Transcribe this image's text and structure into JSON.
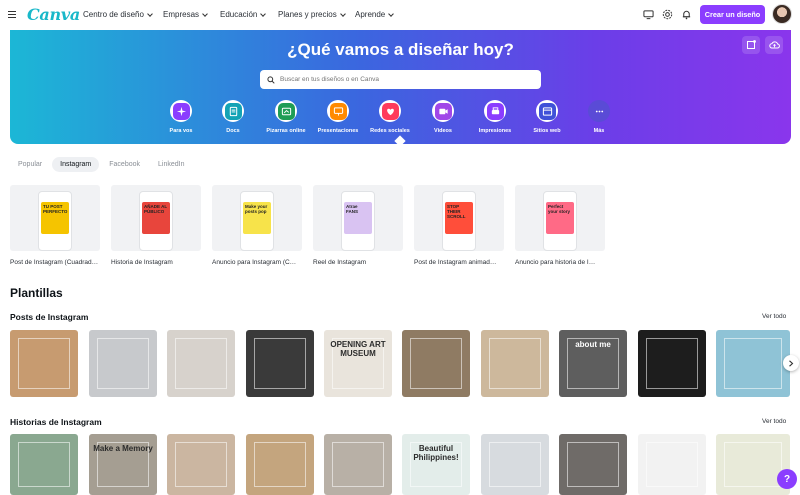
{
  "app": {
    "logo": "Canva"
  },
  "nav": {
    "items": [
      {
        "label": "Centro de diseño"
      },
      {
        "label": "Empresas"
      },
      {
        "label": "Educación"
      },
      {
        "label": "Planes y precios"
      },
      {
        "label": "Aprende"
      }
    ],
    "create_label": "Crear un diseño"
  },
  "hero": {
    "title": "¿Qué vamos a diseñar hoy?",
    "search_placeholder": "Buscar en tus diseños o en Canva",
    "categories": [
      {
        "label": "Para vos",
        "icon": "sparkle-icon",
        "color": "#8b3dff"
      },
      {
        "label": "Docs",
        "icon": "doc-icon",
        "color": "#13a3b5"
      },
      {
        "label": "Pizarras online",
        "icon": "whiteboard-icon",
        "color": "#1f9d55"
      },
      {
        "label": "Presentaciones",
        "icon": "presentation-icon",
        "color": "#ff8a00"
      },
      {
        "label": "Redes sociales",
        "icon": "heart-icon",
        "color": "#ff3b5c"
      },
      {
        "label": "Videos",
        "icon": "video-icon",
        "color": "#a047e8"
      },
      {
        "label": "Impresiones",
        "icon": "print-icon",
        "color": "#8b3dff"
      },
      {
        "label": "Sitios web",
        "icon": "website-icon",
        "color": "#3f51d8"
      },
      {
        "label": "Más",
        "icon": "more-icon",
        "color": "#5a4bd6"
      }
    ]
  },
  "tabs": [
    {
      "label": "Popular",
      "active": false
    },
    {
      "label": "Instagram",
      "active": true
    },
    {
      "label": "Facebook",
      "active": false
    },
    {
      "label": "LinkedIn",
      "active": false
    }
  ],
  "design_types": [
    {
      "label": "Post de Instagram (Cuadrad…",
      "text": "TU POST PERFECTO",
      "accent": "#f5c400"
    },
    {
      "label": "Historia de Instagram",
      "text": "AÑADE AL PÚBLICO",
      "accent": "#e8453c"
    },
    {
      "label": "Anuncio para Instagram (C…",
      "text": "Make your posts pop",
      "accent": "#f7e34a"
    },
    {
      "label": "Reel de Instagram",
      "text": "Atrae FANS",
      "accent": "#d9c3f2"
    },
    {
      "label": "Post de Instagram animad…",
      "text": "STOP THEIR SCROLL",
      "accent": "#ff4e3a"
    },
    {
      "label": "Anuncio para historia de I…",
      "text": "Perfect your story",
      "accent": "#ff6a86"
    }
  ],
  "templates_title": "Plantillas",
  "rows": [
    {
      "title": "Posts de Instagram",
      "see_all": "Ver todo",
      "items": [
        {
          "text": "",
          "bg": "#c79b70"
        },
        {
          "text": "",
          "bg": "#c7c9cc"
        },
        {
          "text": "",
          "bg": "#d7d2cc"
        },
        {
          "text": "",
          "bg": "#3a3a3a"
        },
        {
          "text": "OPENING ART MUSEUM",
          "bg": "#e9e4dc"
        },
        {
          "text": "",
          "bg": "#8f7b63"
        },
        {
          "text": "",
          "bg": "#cdb89c"
        },
        {
          "text": "about me",
          "bg": "#5e5e5e"
        },
        {
          "text": "",
          "bg": "#1d1d1d"
        },
        {
          "text": "",
          "bg": "#8fc3d6"
        }
      ]
    },
    {
      "title": "Historias de Instagram",
      "see_all": "Ver todo",
      "items": [
        {
          "text": "",
          "bg": "#8aa890"
        },
        {
          "text": "Make a Memory",
          "bg": "#a59e92"
        },
        {
          "text": "",
          "bg": "#cbb6a1"
        },
        {
          "text": "",
          "bg": "#c4a57e"
        },
        {
          "text": "",
          "bg": "#b8b0a6"
        },
        {
          "text": "Beautiful Philippines!",
          "bg": "#e3edea"
        },
        {
          "text": "",
          "bg": "#d7dbdf"
        },
        {
          "text": "",
          "bg": "#6f6b68"
        },
        {
          "text": "",
          "bg": "#f2f2f2"
        },
        {
          "text": "",
          "bg": "#e8ead9"
        }
      ]
    }
  ],
  "help_label": "?"
}
